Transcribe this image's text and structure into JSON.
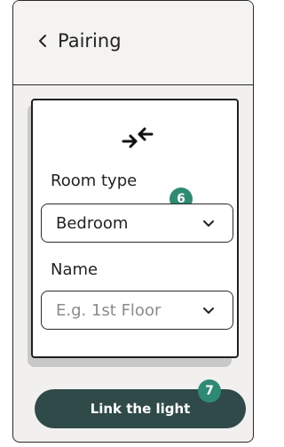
{
  "header": {
    "back_icon": "chevron-left-icon",
    "title": "Pairing"
  },
  "card": {
    "icon": "link-arrows-icon",
    "room_type_label": "Room type",
    "room_type_value": "Bedroom",
    "name_label": "Name",
    "name_placeholder": "E.g. 1st Floor"
  },
  "badges": {
    "step_room_type": "6",
    "step_link": "7"
  },
  "cta": {
    "label": "Link the light"
  },
  "colors": {
    "badge": "#2f8a74",
    "cta": "#2f4a48"
  }
}
